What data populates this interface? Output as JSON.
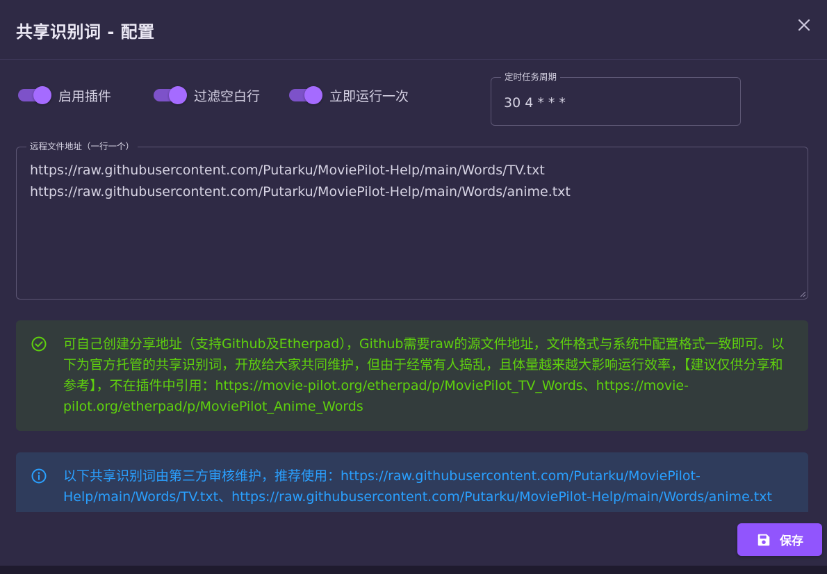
{
  "dialog": {
    "title": "共享识别词 - 配置",
    "close_icon": "close-icon"
  },
  "switches": [
    {
      "label": "启用插件",
      "checked": true
    },
    {
      "label": "过滤空白行",
      "checked": true
    },
    {
      "label": "立即运行一次",
      "checked": true
    }
  ],
  "cron": {
    "label": "定时任务周期",
    "value": "30 4 * * *"
  },
  "urls": {
    "label": "远程文件地址（一行一个）",
    "value": "https://raw.githubusercontent.com/Putarku/MoviePilot-Help/main/Words/TV.txt\nhttps://raw.githubusercontent.com/Putarku/MoviePilot-Help/main/Words/anime.txt"
  },
  "alerts": {
    "success": {
      "icon": "check-circle-icon",
      "color": "#5fd10e",
      "text": "可自己创建分享地址（支持Github及Etherpad），Github需要raw的源文件地址，文件格式与系统中配置格式一致即可。以下为官方托管的共享识别词，开放给大家共同维护，但由于经常有人捣乱，且体量越来越大影响运行效率，【建议仅供分享和参考】，不在插件中引用：https://movie-pilot.org/etherpad/p/MoviePilot_TV_Words、https://movie-pilot.org/etherpad/p/MoviePilot_Anime_Words"
    },
    "info": {
      "icon": "info-circle-icon",
      "color": "#2aa0ff",
      "text": "以下共享识别词由第三方审核维护，推荐使用：https://raw.githubusercontent.com/Putarku/MoviePilot-Help/main/Words/TV.txt、https://raw.githubusercontent.com/Putarku/MoviePilot-Help/main/Words/anime.txt"
    }
  },
  "footer": {
    "save_label": "保存",
    "save_icon": "floppy-disk-icon",
    "accent": "#9155fd"
  }
}
